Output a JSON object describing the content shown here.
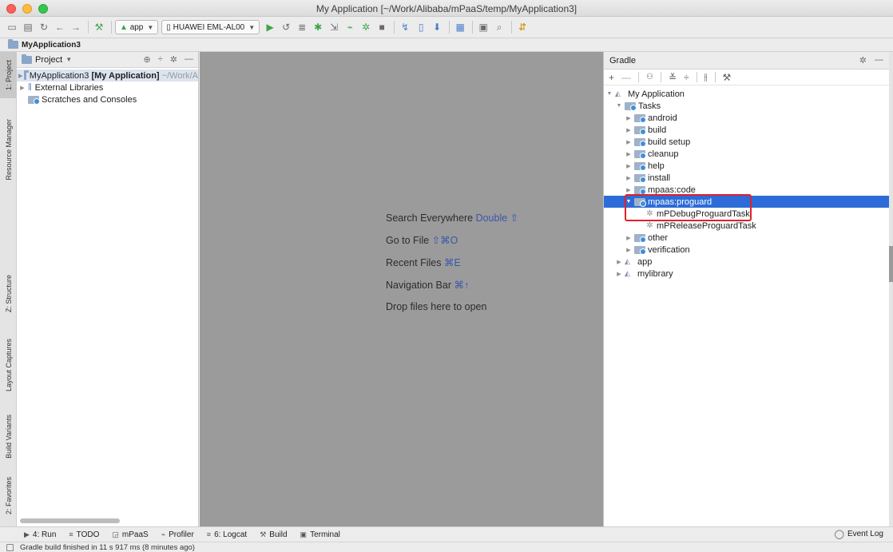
{
  "window": {
    "title": "My Application [~/Work/Alibaba/mPaaS/temp/MyApplication3]"
  },
  "toolbar": {
    "run_config": "app",
    "device": "HUAWEI EML-AL00"
  },
  "breadcrumb": {
    "project": "MyApplication3"
  },
  "left_stripe": [
    {
      "label": "1: Project"
    },
    {
      "label": "Resource Manager"
    },
    {
      "label": "Z: Structure"
    },
    {
      "label": "Layout Captures"
    },
    {
      "label": "Build Variants"
    },
    {
      "label": "2: Favorites"
    }
  ],
  "project_panel": {
    "title": "Project",
    "tree": [
      {
        "name": "MyApplication3",
        "bold": "[My Application]",
        "path": "~/Work/A"
      },
      {
        "name": "External Libraries"
      },
      {
        "name": "Scratches and Consoles"
      }
    ]
  },
  "editor_hints": [
    {
      "text": "Search Everywhere",
      "shortcut": "Double ⇧"
    },
    {
      "text": "Go to File",
      "shortcut": "⇧⌘O"
    },
    {
      "text": "Recent Files",
      "shortcut": "⌘E"
    },
    {
      "text": "Navigation Bar",
      "shortcut": "⌘↑"
    },
    {
      "text": "Drop files here to open",
      "shortcut": ""
    }
  ],
  "gradle_panel": {
    "title": "Gradle",
    "root": "My Application",
    "tasks_label": "Tasks",
    "task_groups": [
      {
        "name": "android"
      },
      {
        "name": "build"
      },
      {
        "name": "build setup"
      },
      {
        "name": "cleanup"
      },
      {
        "name": "help"
      },
      {
        "name": "install"
      },
      {
        "name": "mpaas:code"
      }
    ],
    "selected_group": "mpaas:proguard",
    "selected_children": [
      "mPDebugProguardTask",
      "mPReleaseProguardTask"
    ],
    "after_groups": [
      {
        "name": "other"
      },
      {
        "name": "verification"
      }
    ],
    "modules": [
      "app",
      "mylibrary"
    ]
  },
  "bottom_tools": [
    {
      "icon": "▶",
      "label": "4: Run"
    },
    {
      "icon": "≡",
      "label": "TODO"
    },
    {
      "icon": "◲",
      "label": "mPaaS"
    },
    {
      "icon": "⌁",
      "label": "Profiler"
    },
    {
      "icon": "≡",
      "label": "6: Logcat"
    },
    {
      "icon": "⚒",
      "label": "Build"
    },
    {
      "icon": "▣",
      "label": "Terminal"
    }
  ],
  "event_log": "Event Log",
  "status": "Gradle build finished in 11 s 917 ms (8 minutes ago)"
}
